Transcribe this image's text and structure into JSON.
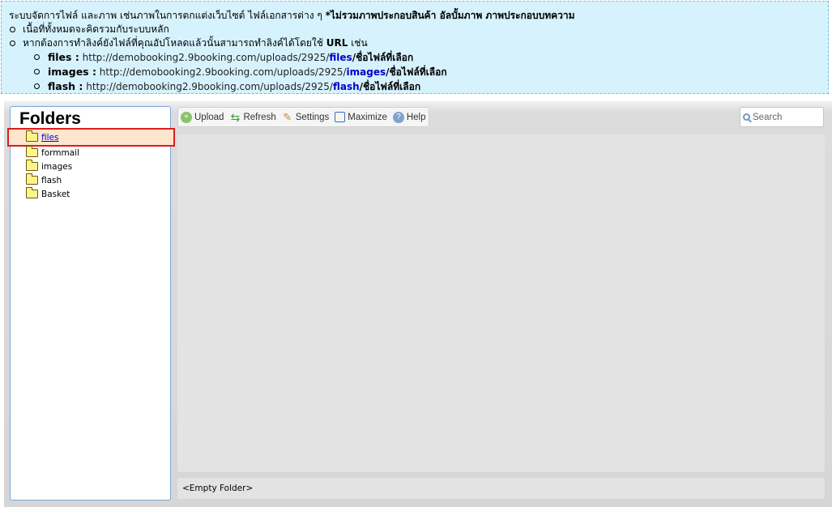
{
  "info": {
    "lead_text": "ระบบจัดการไฟล์ และภาพ เช่นภาพในการตกแต่งเว็บไซต์ ไฟล์เอกสารต่าง ๆ ",
    "lead_bold": "*ไม่รวมภาพประกอบสินค้า อัลบั้มภาพ ภาพประกอบบทความ",
    "bullet1": "เนื้อที่ทั้งหมดจะคิดรวมกับระบบหลัก",
    "bullet2_text": "หากต้องการทำลิงค์ยังไฟล์ที่คุณอัปโหลดแล้วนั้นสามารถทำลิงค์ได้โดยใช้ ",
    "bullet2_bold": "URL",
    "bullet2_end": " เช่น",
    "examples": [
      {
        "key": "files :",
        "url": "http://demobooking2.9booking.com/uploads/2925/",
        "folder": "files",
        "tail": "/ชื่อไฟล์ที่เลือก"
      },
      {
        "key": "images :",
        "url": "http://demobooking2.9booking.com/uploads/2925/",
        "folder": "images",
        "tail": "/ชื่อไฟล์ที่เลือก"
      },
      {
        "key": "flash :",
        "url": "http://demobooking2.9booking.com/uploads/2925/",
        "folder": "flash",
        "tail": "/ชื่อไฟล์ที่เลือก"
      }
    ],
    "colors": {
      "background": "#d6f2fd",
      "border": "#6cc1de",
      "highlight": "#0000cc"
    }
  },
  "folders_panel": {
    "title": "Folders",
    "items": [
      {
        "label": "files",
        "selected": true
      },
      {
        "label": "formmail",
        "selected": false
      },
      {
        "label": "images",
        "selected": false
      },
      {
        "label": "flash",
        "selected": false
      },
      {
        "label": "Basket",
        "selected": false
      }
    ]
  },
  "toolbar": {
    "upload": {
      "label": "Upload",
      "icon": "plus-circle-icon"
    },
    "refresh": {
      "label": "Refresh",
      "icon": "refresh-icon"
    },
    "settings": {
      "label": "Settings",
      "icon": "wrench-icon"
    },
    "maximize": {
      "label": "Maximize",
      "icon": "maximize-icon"
    },
    "help": {
      "label": "Help",
      "icon": "help-icon"
    }
  },
  "search": {
    "placeholder": "Search"
  },
  "status": {
    "text": "<Empty Folder>"
  }
}
